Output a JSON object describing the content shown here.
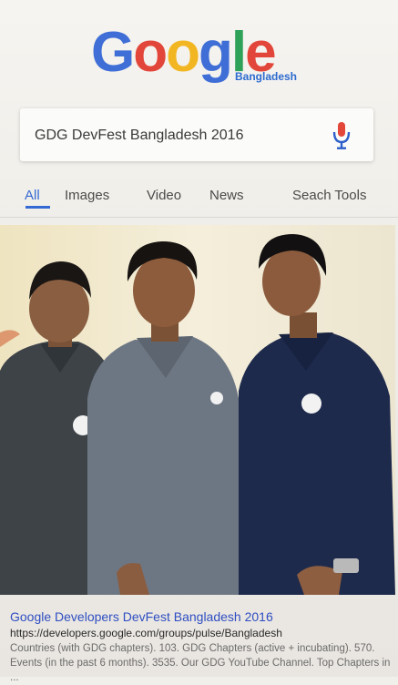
{
  "logo": {
    "letters": [
      "G",
      "o",
      "o",
      "g",
      "l",
      "e"
    ],
    "subtitle": "Bangladesh",
    "colors": {
      "blue": "#3f6fd6",
      "red": "#e2463a",
      "yellow": "#f2b623",
      "green": "#2fa25a"
    }
  },
  "search": {
    "query": "GDG DevFest Bangladesh 2016",
    "icon": "microphone-icon"
  },
  "tabs": [
    {
      "label": "All",
      "active": true
    },
    {
      "label": "Images",
      "active": false
    },
    {
      "label": "Video",
      "active": false
    },
    {
      "label": "News",
      "active": false
    },
    {
      "label": "Seach Tools",
      "active": false
    }
  ],
  "result": {
    "title": "Google Developers DevFest Bangladesh 2016",
    "url": "https://developers.google.com/groups/pulse/Bangladesh",
    "snippet": "Countries (with GDG chapters). 103. GDG Chapters (active + incubating). 570. Events (in the past 6 months). 3535. Our GDG YouTube Channel. Top Chapters in ..."
  },
  "accent_color": "#3569d4"
}
